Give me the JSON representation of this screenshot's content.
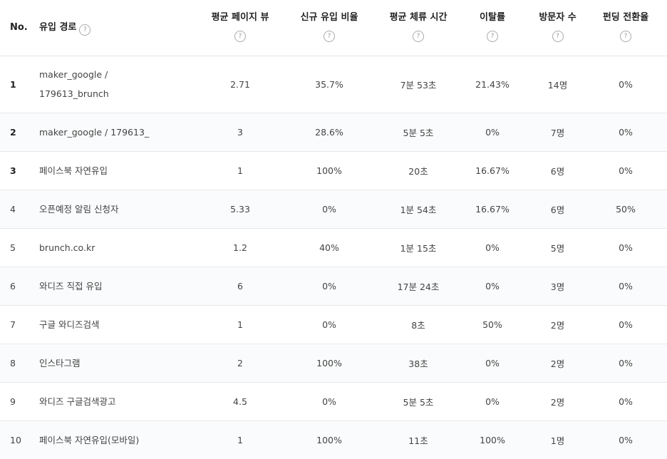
{
  "headers": {
    "no": "No.",
    "source": "유입 경로",
    "avg_pageview": "평균 페이지 뷰",
    "new_ratio": "신규 유입 비율",
    "avg_duration": "평균 체류 시간",
    "bounce_rate": "이탈률",
    "visitors": "방문자 수",
    "funding_conversion": "펀딩 전환율",
    "help_icon_glyph": "?"
  },
  "rows": [
    {
      "no": "1",
      "source": "maker_google /\n179613_brunch",
      "pv": "2.71",
      "new": "35.7%",
      "duration": "7분 53초",
      "bounce": "21.43%",
      "visitors": "14명",
      "conv": "0%"
    },
    {
      "no": "2",
      "source": "maker_google / 179613_",
      "pv": "3",
      "new": "28.6%",
      "duration": "5분 5초",
      "bounce": "0%",
      "visitors": "7명",
      "conv": "0%"
    },
    {
      "no": "3",
      "source": "페이스북 자연유입",
      "pv": "1",
      "new": "100%",
      "duration": "20초",
      "bounce": "16.67%",
      "visitors": "6명",
      "conv": "0%"
    },
    {
      "no": "4",
      "source": "오픈예정 알림 신청자",
      "pv": "5.33",
      "new": "0%",
      "duration": "1분 54초",
      "bounce": "16.67%",
      "visitors": "6명",
      "conv": "50%"
    },
    {
      "no": "5",
      "source": "brunch.co.kr",
      "pv": "1.2",
      "new": "40%",
      "duration": "1분 15초",
      "bounce": "0%",
      "visitors": "5명",
      "conv": "0%"
    },
    {
      "no": "6",
      "source": "와디즈 직접 유입",
      "pv": "6",
      "new": "0%",
      "duration": "17분 24초",
      "bounce": "0%",
      "visitors": "3명",
      "conv": "0%"
    },
    {
      "no": "7",
      "source": "구글 와디즈검색",
      "pv": "1",
      "new": "0%",
      "duration": "8초",
      "bounce": "50%",
      "visitors": "2명",
      "conv": "0%"
    },
    {
      "no": "8",
      "source": "인스타그램",
      "pv": "2",
      "new": "100%",
      "duration": "38초",
      "bounce": "0%",
      "visitors": "2명",
      "conv": "0%"
    },
    {
      "no": "9",
      "source": "와디즈 구글검색광고",
      "pv": "4.5",
      "new": "0%",
      "duration": "5분 5초",
      "bounce": "0%",
      "visitors": "2명",
      "conv": "0%"
    },
    {
      "no": "10",
      "source": "페이스북 자연유입(모바일)",
      "pv": "1",
      "new": "100%",
      "duration": "11초",
      "bounce": "100%",
      "visitors": "1명",
      "conv": "0%"
    }
  ]
}
